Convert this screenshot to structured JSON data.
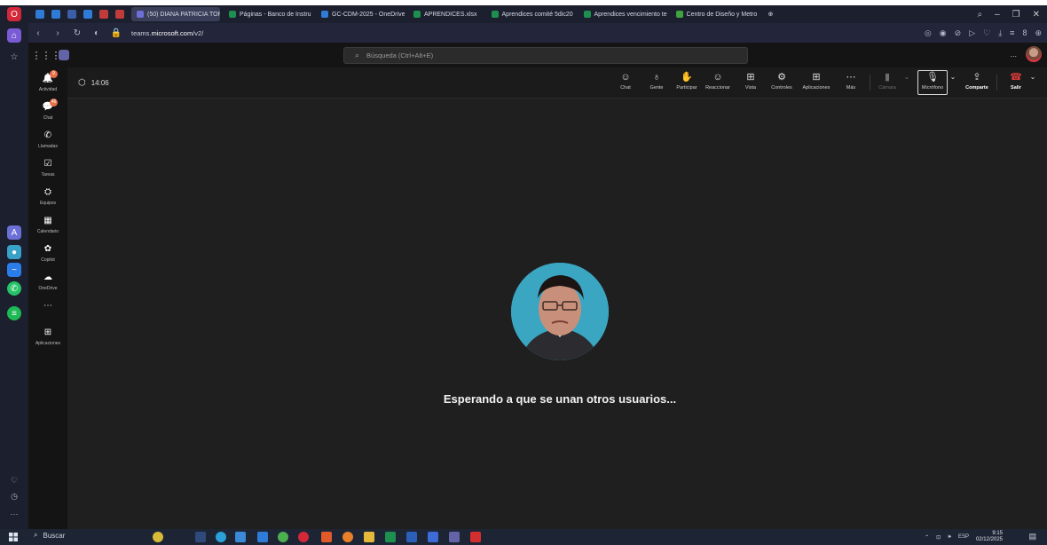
{
  "browser": {
    "tabs": [
      {
        "label": "(50) DIANA PATRICIA TOR",
        "color": "#6b6fd6",
        "active": true
      },
      {
        "label": "Páginas - Banco de Instru",
        "color": "#1d8f4e"
      },
      {
        "label": "GC-CDM-2025 - OneDrive",
        "color": "#2f7bd8"
      },
      {
        "label": "APRENDICES.xlsx",
        "color": "#1d8f4e"
      },
      {
        "label": "Aprendices comité 5dic20",
        "color": "#1d8f4e"
      },
      {
        "label": "Aprendices vencimiento te",
        "color": "#1d8f4e"
      },
      {
        "label": "Centro de Diseño y Metro",
        "color": "#3ea53e"
      }
    ],
    "url_prefix": "teams.",
    "url_domain": "microsoft.com",
    "url_path": "/v2/"
  },
  "teams": {
    "search_placeholder": "Búsqueda (Ctrl+Alt+E)",
    "more": "...",
    "rail": [
      {
        "label": "Actividad",
        "icon": "bell-icon",
        "badge": "9"
      },
      {
        "label": "Chat",
        "icon": "chat-icon",
        "badge": "46"
      },
      {
        "label": "Llamadas",
        "icon": "phone-icon"
      },
      {
        "label": "Tareas",
        "icon": "tasks-icon"
      },
      {
        "label": "Equipos",
        "icon": "teams-icon"
      },
      {
        "label": "Calendario",
        "icon": "calendar-icon"
      },
      {
        "label": "Copilot",
        "icon": "copilot-icon"
      },
      {
        "label": "OneDrive",
        "icon": "cloud-icon"
      },
      {
        "label": "...",
        "icon": "more-icon"
      },
      {
        "label": "Aplicaciones",
        "icon": "apps-icon"
      }
    ]
  },
  "meeting": {
    "time": "14:06",
    "tools": {
      "chat": "Chat",
      "people": "Gente",
      "raise": "Participar",
      "react": "Reaccionar",
      "view": "Vista",
      "controls": "Controles",
      "apps": "Aplicaciones",
      "more": "Más",
      "camera": "Cámara",
      "mic": "Micrófono",
      "share": "Comparte",
      "leave": "Salir"
    },
    "waiting_text": "Esperando a que se unan otros usuarios..."
  },
  "taskbar": {
    "search": "Buscar",
    "lang": "ESP",
    "time": "9:15",
    "date": "02/12/2025"
  }
}
